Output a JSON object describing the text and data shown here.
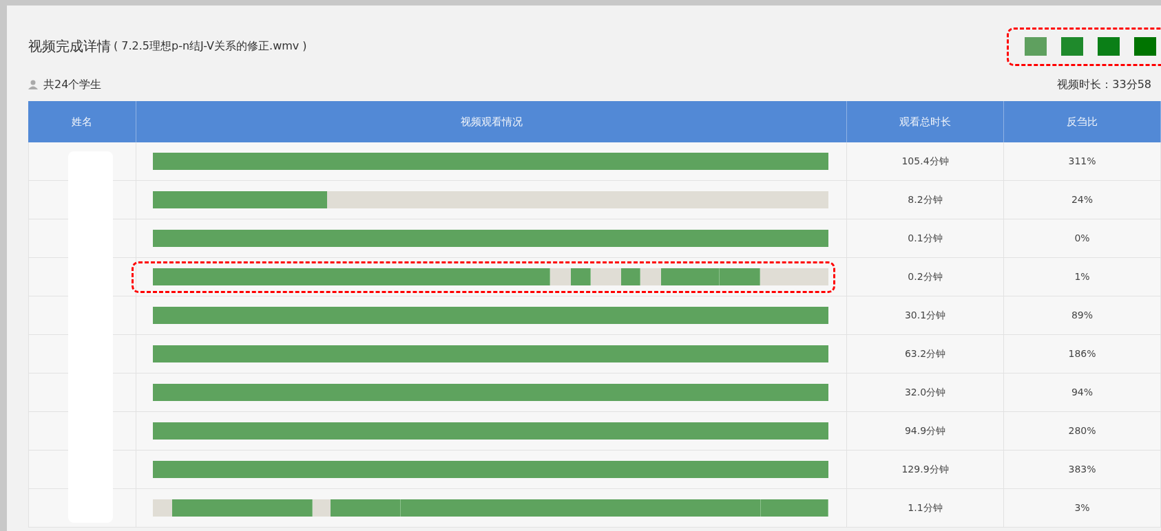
{
  "title": "视频完成详情",
  "file_name": "( 7.2.5理想p-n结J-V关系的修正.wmv )",
  "student_count": "共24个学生",
  "video_length": "视频时长：33分58",
  "legend": [
    {
      "color": "#5fa05f"
    },
    {
      "color": "#1f8a2c"
    },
    {
      "color": "#0b7f17"
    },
    {
      "color": "#007400"
    }
  ],
  "table": {
    "columns": [
      "姓名",
      "视频观看情况",
      "观看总时长",
      "反刍比"
    ],
    "rows": [
      {
        "level": 1,
        "total": "105.4分钟",
        "ratio": "311%"
      },
      {
        "level": 0.258,
        "total": "8.2分钟",
        "ratio": "24%"
      },
      {
        "level": 1,
        "total": "0.1分钟",
        "ratio": "0%"
      },
      {
        "highlighted": true,
        "segments": [
          {
            "kind": "watched"
          },
          {
            "kind": "unwatched"
          },
          {
            "kind": "watched"
          },
          {
            "kind": "unwatched"
          },
          {
            "kind": "watched"
          },
          {
            "kind": "unwatched"
          },
          {
            "kind": "watched"
          },
          {
            "kind": "watched"
          },
          {
            "kind": "unwatched"
          }
        ],
        "total": "0.2分钟",
        "ratio": "1%"
      },
      {
        "level": 1,
        "total": "30.1分钟",
        "ratio": "89%"
      },
      {
        "level": 1,
        "total": "63.2分钟",
        "ratio": "186%"
      },
      {
        "level": 1,
        "total": "32.0分钟",
        "ratio": "94%"
      },
      {
        "level": 1,
        "total": "94.9分钟",
        "ratio": "280%"
      },
      {
        "level": 1,
        "total": "129.9分钟",
        "ratio": "383%"
      },
      {
        "segments": [
          {
            "kind": "unwatched"
          },
          {
            "kind": "watched"
          },
          {
            "kind": "unwatched"
          },
          {
            "kind": "watched"
          },
          {
            "kind": "watched"
          },
          {
            "kind": "watched"
          }
        ],
        "total": "1.1分钟",
        "ratio": "3%"
      }
    ]
  }
}
